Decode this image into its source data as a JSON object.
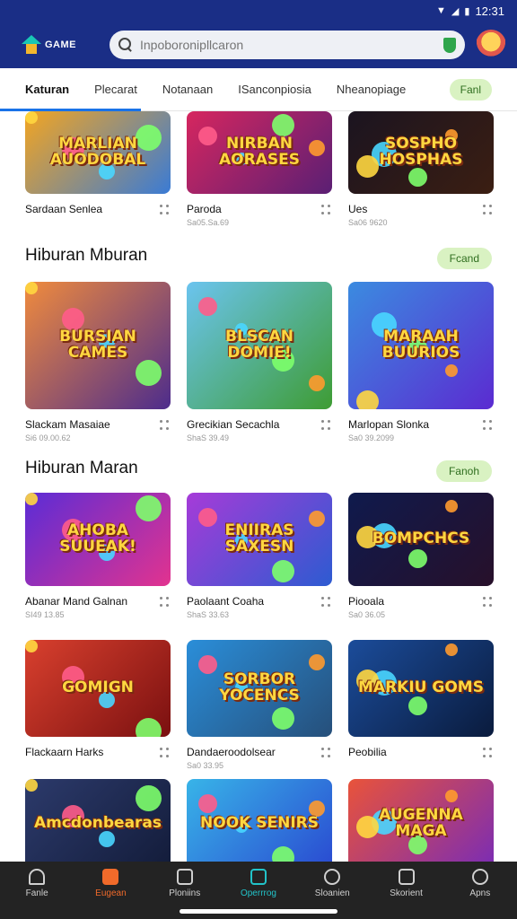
{
  "status": {
    "time": "12:31"
  },
  "header": {
    "logo_text": "GAME",
    "search_placeholder": "Inpoboronipllcaron",
    "avatar_alt": "avatar"
  },
  "tabs": [
    {
      "label": "Katuran",
      "active": true
    },
    {
      "label": "Plecarat",
      "active": false
    },
    {
      "label": "Notanaan",
      "active": false
    },
    {
      "label": "ISanconpiosia",
      "active": false
    },
    {
      "label": "Nheanopiage",
      "active": false
    }
  ],
  "tabs_pill": "Fanl",
  "row0": [
    {
      "title": "MARLIAN AUODOBAL",
      "name": "Sardaan Senlea",
      "sub": "",
      "bg": [
        "#f3a521",
        "#3a7bd5"
      ]
    },
    {
      "title": "NIRBAN AORASES",
      "name": "Paroda",
      "sub": "Sa05.Sa.69",
      "bg": [
        "#d6265f",
        "#5a1f74"
      ]
    },
    {
      "title": "SOSPHO HOSPHAS",
      "name": "Ues",
      "sub": "Sa06 9620",
      "bg": [
        "#1b1420",
        "#3b1e12"
      ]
    }
  ],
  "section1": {
    "title": "Hiburan Mburan",
    "pill": "Fcand"
  },
  "row1": [
    {
      "title": "BURSIAN CAMES",
      "name": "Slackam Masaiae",
      "sub": "Si6 09.00.62",
      "bg": [
        "#f08b3d",
        "#4d2c8c"
      ]
    },
    {
      "title": "BLSCAN DOMIE!",
      "name": "Grecikian Secachla",
      "sub": "ShaS 39.49",
      "bg": [
        "#6bc4ef",
        "#3e9c33"
      ]
    },
    {
      "title": "MARAAH BUURIOS",
      "name": "Marlopan Slonka",
      "sub": "Sa0 39.2099",
      "bg": [
        "#3b8be0",
        "#5b2bd1"
      ]
    }
  ],
  "section2": {
    "title": "Hiburan Maran",
    "pill": "Fanoh"
  },
  "row2": [
    {
      "title": "AHOBA SUUEAK!",
      "name": "Abanar Mand Galnan",
      "sub": "SI49 13.85",
      "bg": [
        "#5b2cd6",
        "#e2338f"
      ]
    },
    {
      "title": "ENIIRAS SAXESN",
      "name": "Paolaant Coaha",
      "sub": "ShaS 33.63",
      "bg": [
        "#a63bd8",
        "#2d5bd1"
      ]
    },
    {
      "title": "BOMPCHCS",
      "name": "Piooala",
      "sub": "Sa0 36.05",
      "bg": [
        "#0f1a4d",
        "#27102a"
      ]
    }
  ],
  "row3": [
    {
      "title": "GOMIGN",
      "name": "Flackaarn Harks",
      "sub": "",
      "bg": [
        "#d9402e",
        "#7a1010"
      ]
    },
    {
      "title": "SORBOR YOCENCS",
      "name": "Dandaeroodolsear",
      "sub": "Sa0 33.95",
      "bg": [
        "#2a8ed9",
        "#264f7a"
      ]
    },
    {
      "title": "MARKIU GOMS",
      "name": "Peobilia",
      "sub": "",
      "bg": [
        "#1b4c9a",
        "#0a1b3d"
      ]
    }
  ],
  "row4": [
    {
      "title": "Amcdonbearas",
      "name": "",
      "sub": "",
      "bg": [
        "#2c3a6b",
        "#131c3a"
      ]
    },
    {
      "title": "NOOK SENIRS",
      "name": "",
      "sub": "",
      "bg": [
        "#38b4e8",
        "#2a4ad1"
      ]
    },
    {
      "title": "AUGENNA MAGA",
      "name": "",
      "sub": "",
      "bg": [
        "#e9533a",
        "#7a2cb5"
      ]
    }
  ],
  "bottom_nav": [
    {
      "label": "Fanle",
      "icon": "home-icon",
      "variant": "home"
    },
    {
      "label": "Eugean",
      "icon": "game-icon",
      "variant": "orange"
    },
    {
      "label": "Ploniins",
      "icon": "chat-icon",
      "variant": ""
    },
    {
      "label": "Operrrog",
      "icon": "store-icon",
      "variant": "teal"
    },
    {
      "label": "Sloanien",
      "icon": "alien-icon",
      "variant": "round"
    },
    {
      "label": "Skorient",
      "icon": "notification-icon",
      "variant": ""
    },
    {
      "label": "Apns",
      "icon": "search-icon",
      "variant": "round"
    }
  ]
}
